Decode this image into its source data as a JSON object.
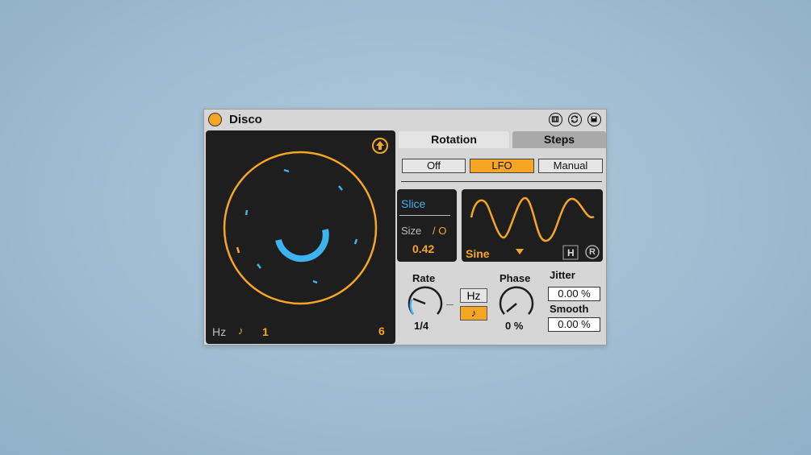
{
  "device": {
    "title": "Disco",
    "colors": {
      "accent": "#f6a623",
      "blue": "#3db4f2",
      "panel": "#1e1e1e",
      "body": "#d6d6d6"
    },
    "titlebar_icons": [
      "hot-swap-icon",
      "refresh-icon",
      "save-icon"
    ]
  },
  "display": {
    "hz_label": "Hz",
    "note_glyph": "♪",
    "left_value": "1",
    "right_value": "6",
    "arrow_icon": "up-arrow-icon"
  },
  "tabs": {
    "rotation": "Rotation",
    "steps": "Steps"
  },
  "modes": {
    "off": "Off",
    "lfo": "LFO",
    "manual": "Manual",
    "selected": "LFO"
  },
  "slice": {
    "label": "Slice",
    "size_label": "Size",
    "size_icon": "/ O",
    "size_value": "0.42"
  },
  "waveform": {
    "shape": "Sine",
    "dropdown_glyph": "▼",
    "hold_label": "H",
    "retrigger_label": "R"
  },
  "rate": {
    "label": "Rate",
    "value": "1/4",
    "knob_fraction": 0.25,
    "hz_button": "Hz",
    "sync_glyph": "♪"
  },
  "phase": {
    "label": "Phase",
    "value": "0 %",
    "knob_fraction": 0.0
  },
  "jitter": {
    "label": "Jitter",
    "value": "0.00 %"
  },
  "smooth": {
    "label": "Smooth",
    "value": "0.00 %"
  }
}
